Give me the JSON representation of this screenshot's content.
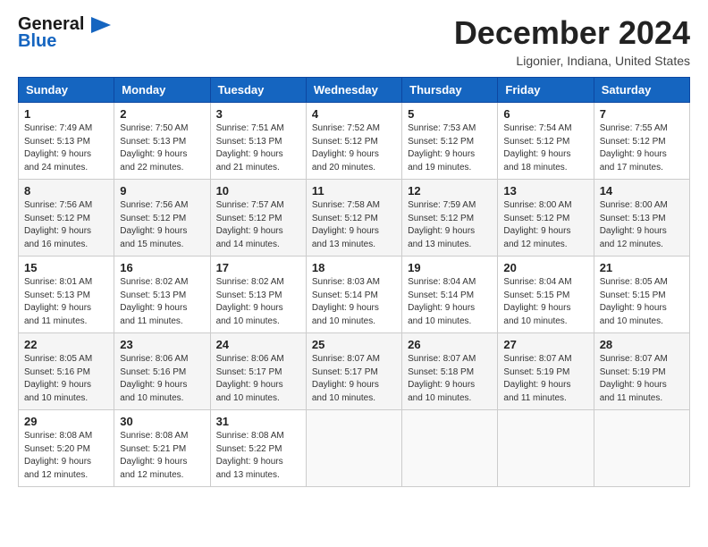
{
  "logo": {
    "line1": "General",
    "line2": "Blue",
    "icon": "▶"
  },
  "title": "December 2024",
  "location": "Ligonier, Indiana, United States",
  "days_header": [
    "Sunday",
    "Monday",
    "Tuesday",
    "Wednesday",
    "Thursday",
    "Friday",
    "Saturday"
  ],
  "weeks": [
    [
      {
        "day": "1",
        "sunrise": "Sunrise: 7:49 AM",
        "sunset": "Sunset: 5:13 PM",
        "daylight": "Daylight: 9 hours and 24 minutes."
      },
      {
        "day": "2",
        "sunrise": "Sunrise: 7:50 AM",
        "sunset": "Sunset: 5:13 PM",
        "daylight": "Daylight: 9 hours and 22 minutes."
      },
      {
        "day": "3",
        "sunrise": "Sunrise: 7:51 AM",
        "sunset": "Sunset: 5:13 PM",
        "daylight": "Daylight: 9 hours and 21 minutes."
      },
      {
        "day": "4",
        "sunrise": "Sunrise: 7:52 AM",
        "sunset": "Sunset: 5:12 PM",
        "daylight": "Daylight: 9 hours and 20 minutes."
      },
      {
        "day": "5",
        "sunrise": "Sunrise: 7:53 AM",
        "sunset": "Sunset: 5:12 PM",
        "daylight": "Daylight: 9 hours and 19 minutes."
      },
      {
        "day": "6",
        "sunrise": "Sunrise: 7:54 AM",
        "sunset": "Sunset: 5:12 PM",
        "daylight": "Daylight: 9 hours and 18 minutes."
      },
      {
        "day": "7",
        "sunrise": "Sunrise: 7:55 AM",
        "sunset": "Sunset: 5:12 PM",
        "daylight": "Daylight: 9 hours and 17 minutes."
      }
    ],
    [
      {
        "day": "8",
        "sunrise": "Sunrise: 7:56 AM",
        "sunset": "Sunset: 5:12 PM",
        "daylight": "Daylight: 9 hours and 16 minutes."
      },
      {
        "day": "9",
        "sunrise": "Sunrise: 7:56 AM",
        "sunset": "Sunset: 5:12 PM",
        "daylight": "Daylight: 9 hours and 15 minutes."
      },
      {
        "day": "10",
        "sunrise": "Sunrise: 7:57 AM",
        "sunset": "Sunset: 5:12 PM",
        "daylight": "Daylight: 9 hours and 14 minutes."
      },
      {
        "day": "11",
        "sunrise": "Sunrise: 7:58 AM",
        "sunset": "Sunset: 5:12 PM",
        "daylight": "Daylight: 9 hours and 13 minutes."
      },
      {
        "day": "12",
        "sunrise": "Sunrise: 7:59 AM",
        "sunset": "Sunset: 5:12 PM",
        "daylight": "Daylight: 9 hours and 13 minutes."
      },
      {
        "day": "13",
        "sunrise": "Sunrise: 8:00 AM",
        "sunset": "Sunset: 5:12 PM",
        "daylight": "Daylight: 9 hours and 12 minutes."
      },
      {
        "day": "14",
        "sunrise": "Sunrise: 8:00 AM",
        "sunset": "Sunset: 5:13 PM",
        "daylight": "Daylight: 9 hours and 12 minutes."
      }
    ],
    [
      {
        "day": "15",
        "sunrise": "Sunrise: 8:01 AM",
        "sunset": "Sunset: 5:13 PM",
        "daylight": "Daylight: 9 hours and 11 minutes."
      },
      {
        "day": "16",
        "sunrise": "Sunrise: 8:02 AM",
        "sunset": "Sunset: 5:13 PM",
        "daylight": "Daylight: 9 hours and 11 minutes."
      },
      {
        "day": "17",
        "sunrise": "Sunrise: 8:02 AM",
        "sunset": "Sunset: 5:13 PM",
        "daylight": "Daylight: 9 hours and 10 minutes."
      },
      {
        "day": "18",
        "sunrise": "Sunrise: 8:03 AM",
        "sunset": "Sunset: 5:14 PM",
        "daylight": "Daylight: 9 hours and 10 minutes."
      },
      {
        "day": "19",
        "sunrise": "Sunrise: 8:04 AM",
        "sunset": "Sunset: 5:14 PM",
        "daylight": "Daylight: 9 hours and 10 minutes."
      },
      {
        "day": "20",
        "sunrise": "Sunrise: 8:04 AM",
        "sunset": "Sunset: 5:15 PM",
        "daylight": "Daylight: 9 hours and 10 minutes."
      },
      {
        "day": "21",
        "sunrise": "Sunrise: 8:05 AM",
        "sunset": "Sunset: 5:15 PM",
        "daylight": "Daylight: 9 hours and 10 minutes."
      }
    ],
    [
      {
        "day": "22",
        "sunrise": "Sunrise: 8:05 AM",
        "sunset": "Sunset: 5:16 PM",
        "daylight": "Daylight: 9 hours and 10 minutes."
      },
      {
        "day": "23",
        "sunrise": "Sunrise: 8:06 AM",
        "sunset": "Sunset: 5:16 PM",
        "daylight": "Daylight: 9 hours and 10 minutes."
      },
      {
        "day": "24",
        "sunrise": "Sunrise: 8:06 AM",
        "sunset": "Sunset: 5:17 PM",
        "daylight": "Daylight: 9 hours and 10 minutes."
      },
      {
        "day": "25",
        "sunrise": "Sunrise: 8:07 AM",
        "sunset": "Sunset: 5:17 PM",
        "daylight": "Daylight: 9 hours and 10 minutes."
      },
      {
        "day": "26",
        "sunrise": "Sunrise: 8:07 AM",
        "sunset": "Sunset: 5:18 PM",
        "daylight": "Daylight: 9 hours and 10 minutes."
      },
      {
        "day": "27",
        "sunrise": "Sunrise: 8:07 AM",
        "sunset": "Sunset: 5:19 PM",
        "daylight": "Daylight: 9 hours and 11 minutes."
      },
      {
        "day": "28",
        "sunrise": "Sunrise: 8:07 AM",
        "sunset": "Sunset: 5:19 PM",
        "daylight": "Daylight: 9 hours and 11 minutes."
      }
    ],
    [
      {
        "day": "29",
        "sunrise": "Sunrise: 8:08 AM",
        "sunset": "Sunset: 5:20 PM",
        "daylight": "Daylight: 9 hours and 12 minutes."
      },
      {
        "day": "30",
        "sunrise": "Sunrise: 8:08 AM",
        "sunset": "Sunset: 5:21 PM",
        "daylight": "Daylight: 9 hours and 12 minutes."
      },
      {
        "day": "31",
        "sunrise": "Sunrise: 8:08 AM",
        "sunset": "Sunset: 5:22 PM",
        "daylight": "Daylight: 9 hours and 13 minutes."
      },
      null,
      null,
      null,
      null
    ]
  ]
}
